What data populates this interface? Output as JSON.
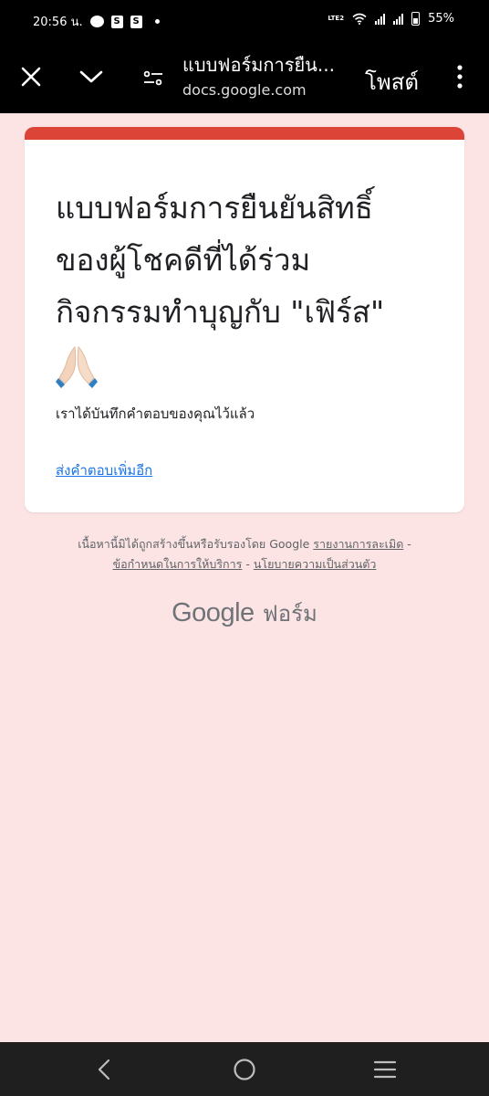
{
  "status_bar": {
    "time": "20:56 น.",
    "shop_glyph": "S",
    "lte_label": "LTE2",
    "battery_percent": "55%"
  },
  "browser": {
    "page_title": "แบบฟอร์มการยืน...",
    "domain": "docs.google.com",
    "post_label": "โพสต์"
  },
  "form": {
    "title": "แบบฟอร์มการยืนยันสิทธิ์ของผู้โชคดีที่ได้ร่วมกิจกรรมทำบุญกับ \"เฟิร์ส\"",
    "title_line1": "แบบฟอร์มการยืนยันสิทธิ์",
    "title_line2": "ของผู้โชคดีที่ได้ร่วม",
    "title_line3": "กิจกรรมทำบุญกับ \"เฟิร์ส\"",
    "message": "เราได้บันทึกคำตอบของคุณไว้แล้ว",
    "resubmit_link": "ส่งคำตอบเพิ่มอีก"
  },
  "footer": {
    "disclaimer": "เนื้อหานี้มิได้ถูกสร้างขึ้นหรือรับรองโดย Google",
    "report_abuse": "รายงานการละเมิด",
    "terms": "ข้อกำหนดในการให้บริการ",
    "privacy": "นโยบายความเป็นส่วนตัว",
    "separator": "-",
    "brand_google": "Google",
    "brand_forms": "ฟอร์ม"
  },
  "colors": {
    "page_bg": "#fce4e4",
    "accent": "#db4437",
    "link": "#1a73e8"
  },
  "icons": {
    "close": "close-icon",
    "chevron": "chevron-down-icon",
    "tune": "tune-icon",
    "menu": "more-vert-icon",
    "pray": "folded-hands-emoji-icon",
    "back": "back-icon",
    "home": "home-icon",
    "recent": "recent-apps-icon"
  }
}
